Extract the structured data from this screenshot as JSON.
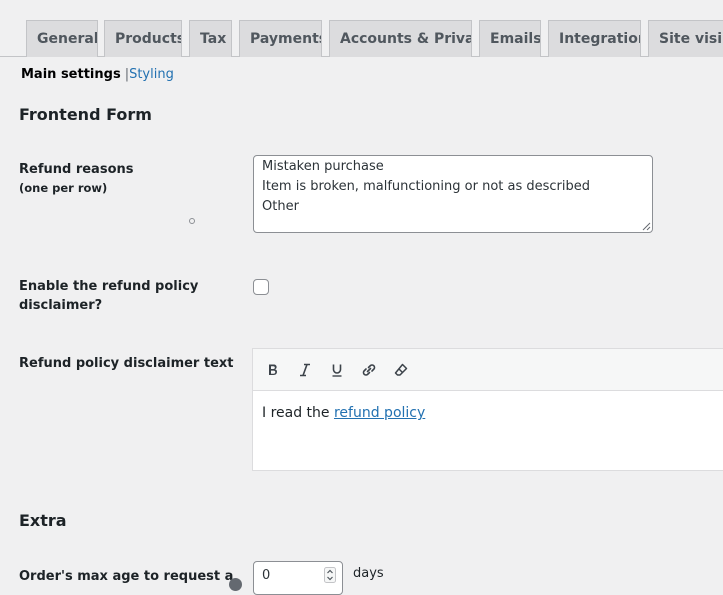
{
  "tabs": [
    {
      "label": "General"
    },
    {
      "label": "Products"
    },
    {
      "label": "Tax"
    },
    {
      "label": "Payments"
    },
    {
      "label": "Accounts & Privacy"
    },
    {
      "label": "Emails"
    },
    {
      "label": "Integration"
    },
    {
      "label": "Site visibility"
    }
  ],
  "subnav": {
    "current": "Main settings",
    "separator": "|",
    "styling": "Styling"
  },
  "frontend": {
    "heading": "Frontend Form",
    "refund_reasons": {
      "label": "Refund reasons",
      "hint": "(one per row)",
      "lines": [
        "Mistaken purchase",
        "Item is broken, malfunctioning or not as described",
        "Other"
      ]
    },
    "disclaimer_enable": {
      "label_line1": "Enable the refund policy",
      "label_line2": "disclaimer?",
      "checked": false
    },
    "disclaimer_text": {
      "label": "Refund policy disclaimer text",
      "text_prefix": "I read the ",
      "link_text": "refund policy"
    }
  },
  "extra": {
    "heading": "Extra",
    "max_age": {
      "label": "Order's max age to request a",
      "value": "0",
      "unit": "days"
    }
  },
  "colors": {
    "accent": "#2271b1",
    "background": "#f0f0f1",
    "tab_bg": "#dcdcde"
  }
}
